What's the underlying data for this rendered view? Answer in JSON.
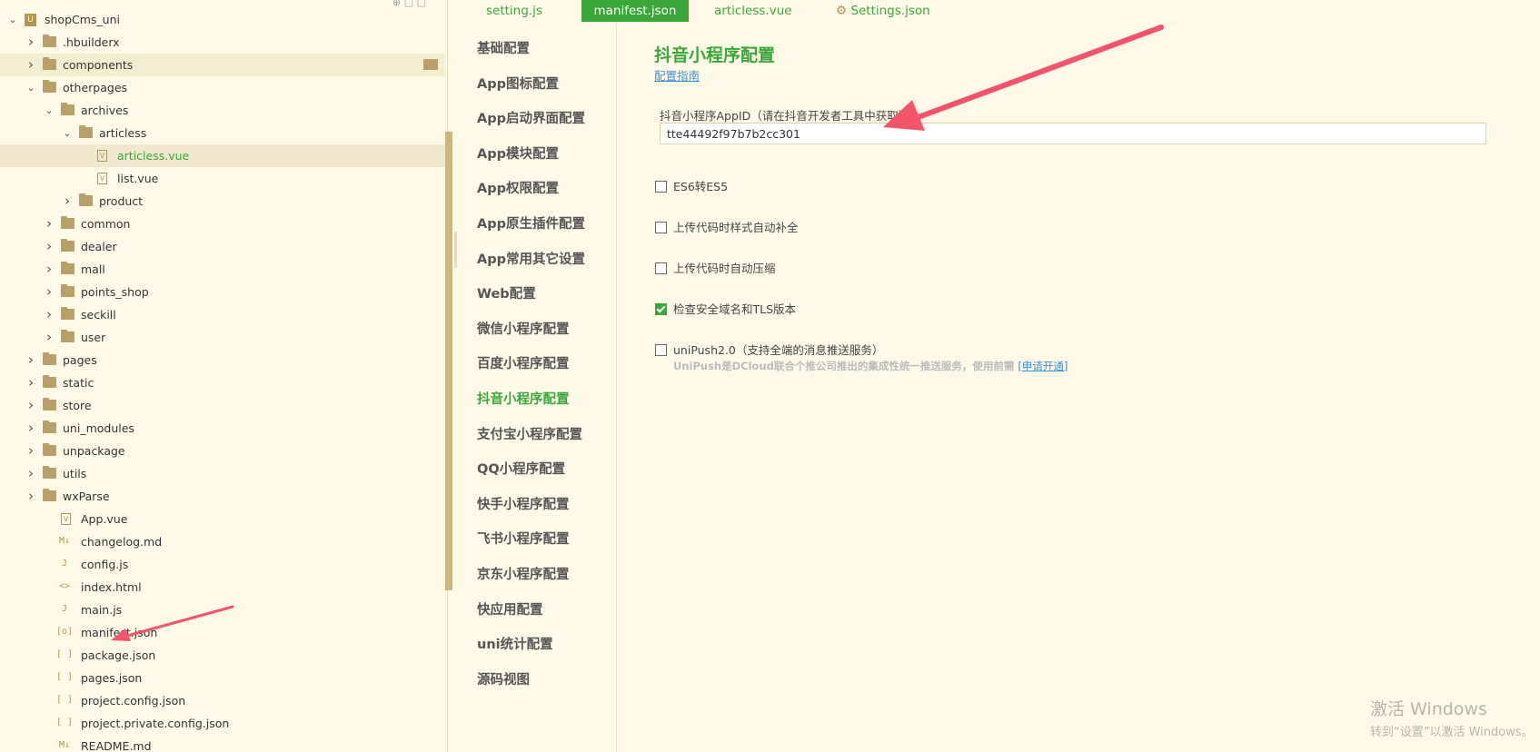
{
  "explorer": {
    "rows": [
      {
        "label": "shopCms_uni",
        "type": "root",
        "depth": 0,
        "chev": "down"
      },
      {
        "label": ".hbuilderx",
        "type": "folder",
        "depth": 1,
        "chev": "right"
      },
      {
        "label": "components",
        "type": "folder",
        "depth": 1,
        "chev": "right",
        "state": "hover"
      },
      {
        "label": "otherpages",
        "type": "folder",
        "depth": 1,
        "chev": "down"
      },
      {
        "label": "archives",
        "type": "folder",
        "depth": 2,
        "chev": "down"
      },
      {
        "label": "articless",
        "type": "folder",
        "depth": 3,
        "chev": "down"
      },
      {
        "label": "articless.vue",
        "type": "vue",
        "depth": 4,
        "state": "selected"
      },
      {
        "label": "list.vue",
        "type": "vue",
        "depth": 4
      },
      {
        "label": "product",
        "type": "folder",
        "depth": 3,
        "chev": "right"
      },
      {
        "label": "common",
        "type": "folder",
        "depth": 2,
        "chev": "right"
      },
      {
        "label": "dealer",
        "type": "folder",
        "depth": 2,
        "chev": "right"
      },
      {
        "label": "mall",
        "type": "folder",
        "depth": 2,
        "chev": "right"
      },
      {
        "label": "points_shop",
        "type": "folder",
        "depth": 2,
        "chev": "right"
      },
      {
        "label": "seckill",
        "type": "folder",
        "depth": 2,
        "chev": "right"
      },
      {
        "label": "user",
        "type": "folder",
        "depth": 2,
        "chev": "right"
      },
      {
        "label": "pages",
        "type": "folder",
        "depth": 1,
        "chev": "right"
      },
      {
        "label": "static",
        "type": "folder",
        "depth": 1,
        "chev": "right"
      },
      {
        "label": "store",
        "type": "folder",
        "depth": 1,
        "chev": "right"
      },
      {
        "label": "uni_modules",
        "type": "folder",
        "depth": 1,
        "chev": "right"
      },
      {
        "label": "unpackage",
        "type": "folder",
        "depth": 1,
        "chev": "right"
      },
      {
        "label": "utils",
        "type": "folder",
        "depth": 1,
        "chev": "right"
      },
      {
        "label": "wxParse",
        "type": "folder",
        "depth": 1,
        "chev": "right"
      },
      {
        "label": "App.vue",
        "type": "vue",
        "depth": 2
      },
      {
        "label": "changelog.md",
        "type": "md",
        "depth": 2
      },
      {
        "label": "config.js",
        "type": "js",
        "depth": 2
      },
      {
        "label": "index.html",
        "type": "html",
        "depth": 2
      },
      {
        "label": "main.js",
        "type": "js",
        "depth": 2
      },
      {
        "label": "manifest.json",
        "type": "manifest",
        "depth": 2
      },
      {
        "label": "package.json",
        "type": "json",
        "depth": 2
      },
      {
        "label": "pages.json",
        "type": "json",
        "depth": 2
      },
      {
        "label": "project.config.json",
        "type": "json",
        "depth": 2
      },
      {
        "label": "project.private.config.json",
        "type": "json",
        "depth": 2
      },
      {
        "label": "README.md",
        "type": "md",
        "depth": 2
      }
    ]
  },
  "icons": {
    "vue": "V",
    "md": "M↓",
    "js": "J",
    "html": "<>",
    "manifest": "[o]",
    "json": "[ ]",
    "root": "U"
  },
  "tabs": [
    {
      "label": "setting.js",
      "active": false
    },
    {
      "label": "manifest.json",
      "active": true
    },
    {
      "label": "articless.vue",
      "active": false
    },
    {
      "label": "Settings.json",
      "active": false,
      "icon": "gear"
    }
  ],
  "nav": {
    "items": [
      "基础配置",
      "App图标配置",
      "App启动界面配置",
      "App模块配置",
      "App权限配置",
      "App原生插件配置",
      "App常用其它设置",
      "Web配置",
      "微信小程序配置",
      "百度小程序配置",
      "抖音小程序配置",
      "支付宝小程序配置",
      "QQ小程序配置",
      "快手小程序配置",
      "飞书小程序配置",
      "京东小程序配置",
      "快应用配置",
      "uni统计配置",
      "源码视图"
    ],
    "active_index": 10
  },
  "content": {
    "title": "抖音小程序配置",
    "guide_link": "配置指南",
    "appid_label": "抖音小程序AppID（请在抖音开发者工具中获取）",
    "appid_value": "tte44492f97b7b2cc301",
    "options": [
      {
        "label": "ES6转ES5",
        "checked": false
      },
      {
        "label": "上传代码时样式自动补全",
        "checked": false
      },
      {
        "label": "上传代码时自动压缩",
        "checked": false
      },
      {
        "label": "检查安全域名和TLS版本",
        "checked": true
      },
      {
        "label": "uniPush2.0（支持全端的消息推送服务）",
        "checked": false
      }
    ],
    "unipush_desc": "UniPush是DCloud联合个推公司推出的集成性统一推送服务，使用前需",
    "unipush_link": "[申请开通]"
  },
  "watermark": {
    "line1": "激活 Windows",
    "line2": "转到“设置”以激活 Windows。"
  },
  "colors": {
    "accent": "#3aa63a",
    "background": "#fffae8",
    "link": "#3a8fd6",
    "arrow": "#f2546a"
  }
}
